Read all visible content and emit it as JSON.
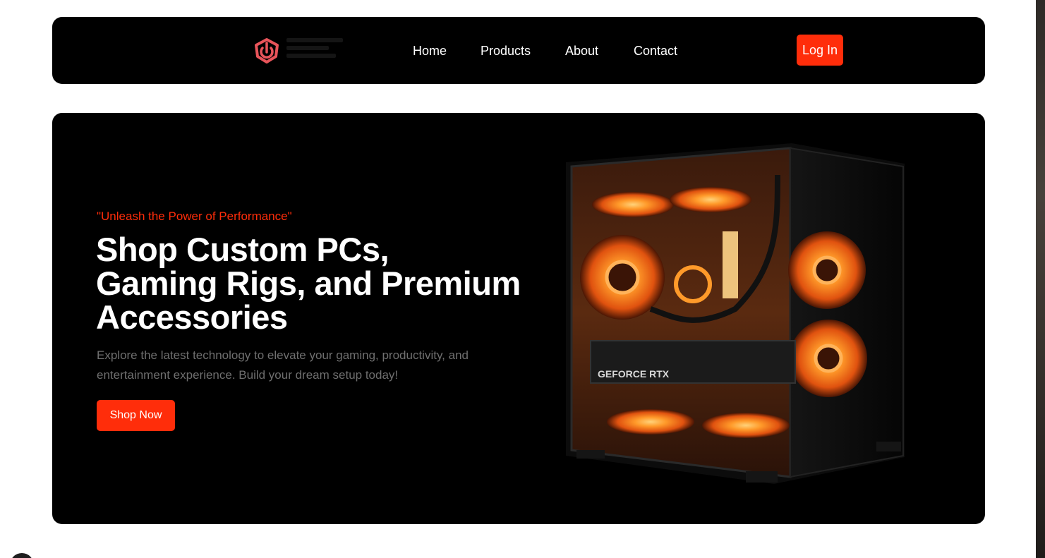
{
  "nav": {
    "links": [
      "Home",
      "Products",
      "About",
      "Contact"
    ],
    "login_label": "Log In"
  },
  "hero": {
    "tagline": "\"Unleash the Power of Performance\"",
    "headline_lines": [
      "Shop Custom PCs,",
      "Gaming Rigs, and Premium",
      "Accessories"
    ],
    "description": "Explore the latest technology to elevate your gaming, productivity, and entertainment experience. Build your dream setup today!",
    "cta_label": "Shop Now",
    "gpu_label": "GEFORCE RTX"
  },
  "icons": {
    "logo": "power-shield-icon"
  },
  "colors": {
    "accent": "#ff2d0a",
    "nav_bg": "#000000",
    "hero_bg": "#000000",
    "muted_text": "#6f6f6f",
    "fan_glow": "#ff8a1e"
  }
}
